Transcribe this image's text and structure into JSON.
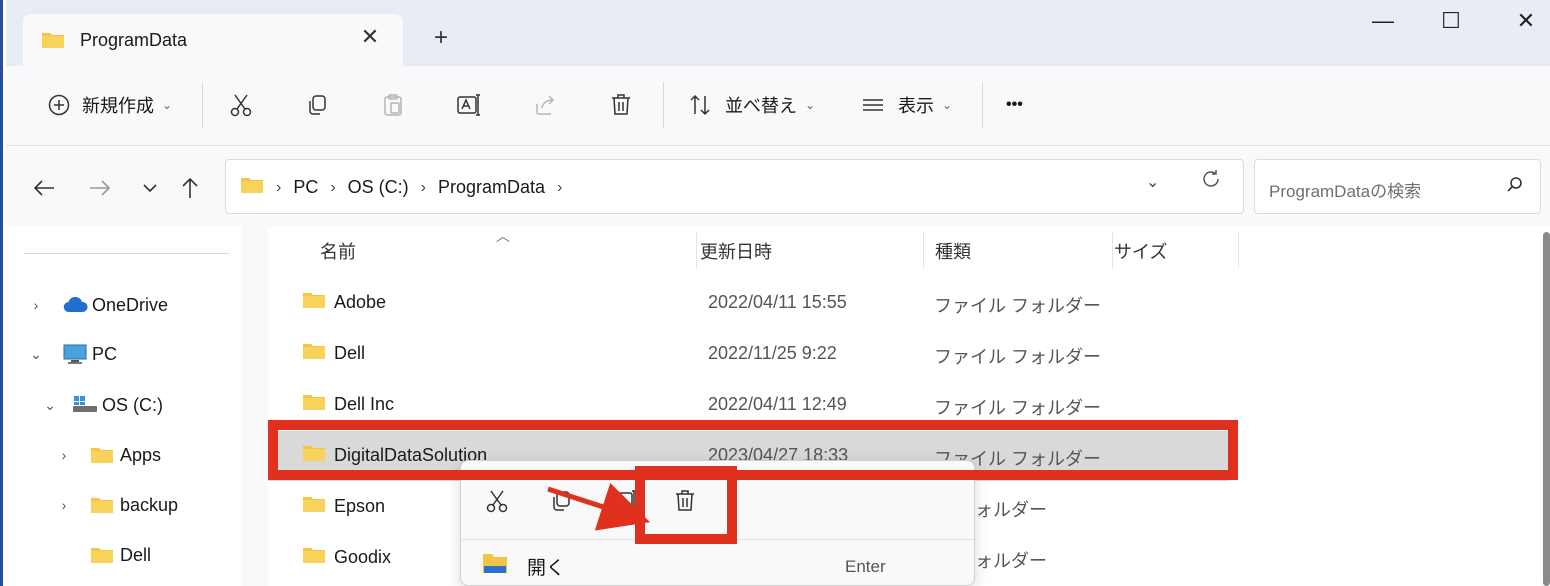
{
  "window": {
    "tab_title": "ProgramData",
    "tab_close": "✕",
    "new_tab": "+",
    "minimize": "—",
    "maximize": "☐",
    "close": "✕"
  },
  "toolbar": {
    "new_label": "新規作成",
    "sort_label": "並べ替え",
    "view_label": "表示",
    "more_label": "•••"
  },
  "address": {
    "crumbs": [
      "PC",
      "OS (C:)",
      "ProgramData"
    ],
    "search_placeholder": "ProgramDataの検索"
  },
  "sidebar": {
    "items": [
      {
        "label": "OneDrive",
        "arrow": "›"
      },
      {
        "label": "PC",
        "arrow": "⌄"
      },
      {
        "label": "OS (C:)",
        "arrow": "⌄"
      },
      {
        "label": "Apps",
        "arrow": "›"
      },
      {
        "label": "backup",
        "arrow": "›"
      },
      {
        "label": "Dell",
        "arrow": ""
      }
    ]
  },
  "columns": {
    "name": "名前",
    "modified": "更新日時",
    "type": "種類",
    "size": "サイズ"
  },
  "files": [
    {
      "name": "Adobe",
      "date": "2022/04/11 15:55",
      "type": "ファイル フォルダー"
    },
    {
      "name": "Dell",
      "date": "2022/11/25 9:22",
      "type": "ファイル フォルダー"
    },
    {
      "name": "Dell Inc",
      "date": "2022/04/11 12:49",
      "type": "ファイル フォルダー"
    },
    {
      "name": "DigitalDataSolution",
      "date": "2023/04/27 18:33",
      "type": "ファイル フォルダー"
    },
    {
      "name": "Epson",
      "date": "",
      "type": "ル フォルダー"
    },
    {
      "name": "Goodix",
      "date": "",
      "type": "ル フォルダー"
    }
  ],
  "context_menu": {
    "open_label": "開く",
    "open_shortcut": "Enter"
  },
  "colors": {
    "highlight": "#e0301e",
    "folder": "#f4c542",
    "selected_row": "#d9d9d9"
  }
}
